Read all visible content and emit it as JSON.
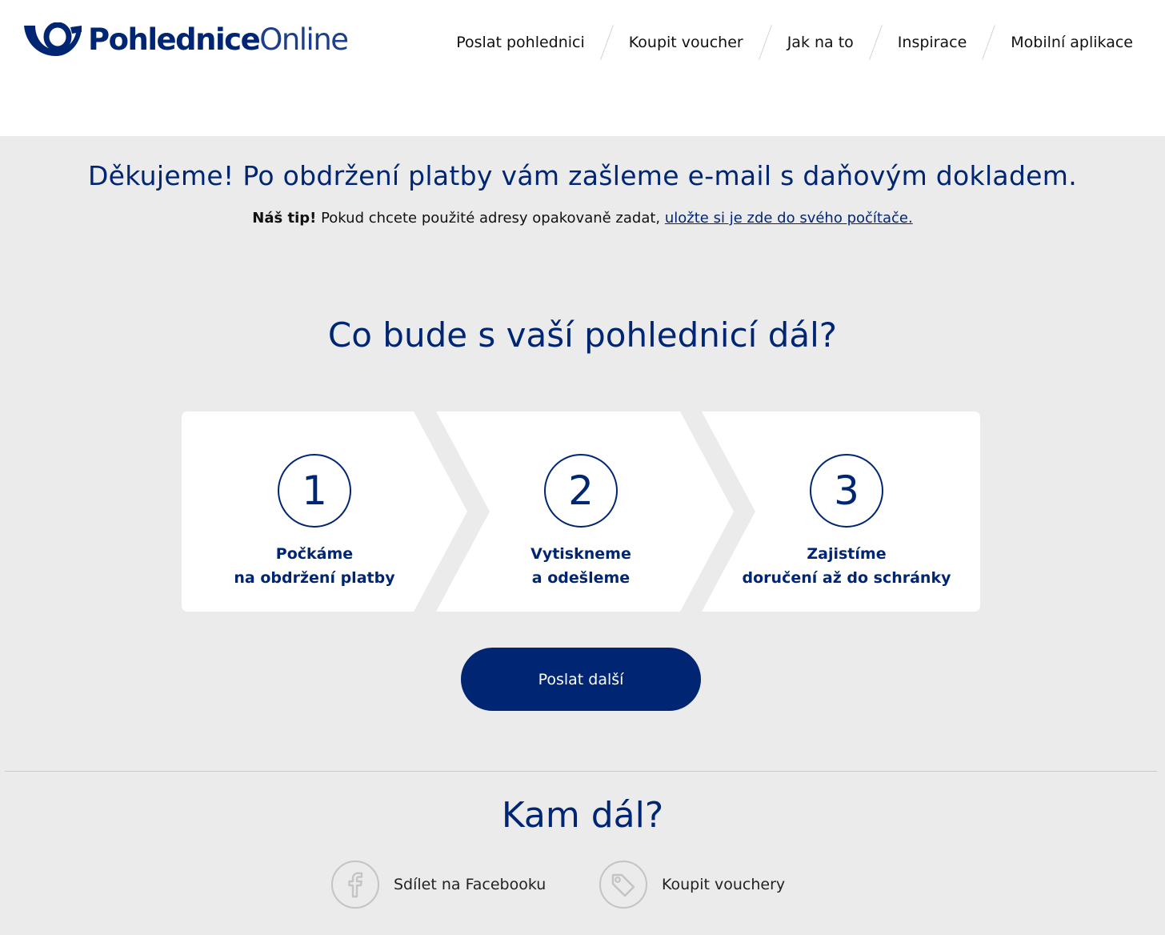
{
  "brand": {
    "name_bold": "Pohlednice",
    "name_light": "Online",
    "color": "#002673"
  },
  "nav": {
    "items": [
      {
        "label": "Poslat pohlednici"
      },
      {
        "label": "Koupit voucher"
      },
      {
        "label": "Jak na to"
      },
      {
        "label": "Inspirace"
      },
      {
        "label": "Mobilní aplikace"
      }
    ]
  },
  "thanks": {
    "headline": "Děkujeme! Po obdržení platby vám zašleme e-mail s daňovým dokladem.",
    "tip_label": "Náš tip!",
    "tip_text": " Pokud chcete použité adresy opakovaně zadat, ",
    "tip_link": "uložte si je zde do svého počítače."
  },
  "process": {
    "title": "Co bude s vaší pohlednicí dál?",
    "steps": [
      {
        "number": "1",
        "line1": "Počkáme",
        "line2": "na obdržení platby"
      },
      {
        "number": "2",
        "line1": "Vytiskneme",
        "line2": "a odešleme"
      },
      {
        "number": "3",
        "line1": "Zajistíme",
        "line2": "doručení až do schránky"
      }
    ],
    "button_label": "Poslat další"
  },
  "next": {
    "title": "Kam dál?",
    "links": [
      {
        "label": "Sdílet na Facebooku",
        "icon": "facebook-icon"
      },
      {
        "label": "Koupit vouchery",
        "icon": "tag-icon"
      }
    ]
  },
  "colors": {
    "primary": "#002673",
    "background": "#ebebeb",
    "card": "#ffffff",
    "icon_gray": "#c4c4c4"
  }
}
